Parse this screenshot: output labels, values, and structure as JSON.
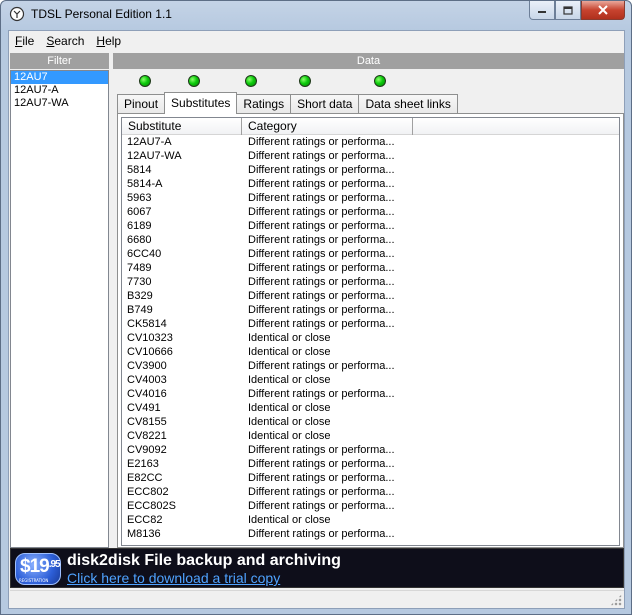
{
  "window": {
    "title": "TDSL Personal Edition 1.1"
  },
  "menu": [
    {
      "label": "File",
      "accel": "F",
      "rest": "ile"
    },
    {
      "label": "Search",
      "accel": "S",
      "rest": "earch"
    },
    {
      "label": "Help",
      "accel": "H",
      "rest": "elp"
    }
  ],
  "filter": {
    "header": "Filter",
    "items": [
      "12AU7",
      "12AU7-A",
      "12AU7-WA"
    ],
    "selected_index": 0
  },
  "data": {
    "header": "Data",
    "led_count": 5,
    "led_color": "#0ccb0c"
  },
  "tabs": [
    "Pinout",
    "Substitutes",
    "Ratings",
    "Short data",
    "Data sheet links"
  ],
  "active_tab": "Substitutes",
  "grid": {
    "columns": [
      "Substitute",
      "Category",
      ""
    ],
    "rows": [
      [
        "12AU7-A",
        "Different ratings or performa..."
      ],
      [
        "12AU7-WA",
        "Different ratings or performa..."
      ],
      [
        "5814",
        "Different ratings or performa..."
      ],
      [
        "5814-A",
        "Different ratings or performa..."
      ],
      [
        "5963",
        "Different ratings or performa..."
      ],
      [
        "6067",
        "Different ratings or performa..."
      ],
      [
        "6189",
        "Different ratings or performa..."
      ],
      [
        "6680",
        "Different ratings or performa..."
      ],
      [
        "6CC40",
        "Different ratings or performa..."
      ],
      [
        "7489",
        "Different ratings or performa..."
      ],
      [
        "7730",
        "Different ratings or performa..."
      ],
      [
        "B329",
        "Different ratings or performa..."
      ],
      [
        "B749",
        "Different ratings or performa..."
      ],
      [
        "CK5814",
        "Different ratings or performa..."
      ],
      [
        "CV10323",
        "Identical or close"
      ],
      [
        "CV10666",
        "Identical or close"
      ],
      [
        "CV3900",
        "Different ratings or performa..."
      ],
      [
        "CV4003",
        "Identical or close"
      ],
      [
        "CV4016",
        "Different ratings or performa..."
      ],
      [
        "CV491",
        "Identical or close"
      ],
      [
        "CV8155",
        "Identical or close"
      ],
      [
        "CV8221",
        "Identical or close"
      ],
      [
        "CV9092",
        "Different ratings or performa..."
      ],
      [
        "E2163",
        "Different ratings or performa..."
      ],
      [
        "E82CC",
        "Different ratings or performa..."
      ],
      [
        "ECC802",
        "Different ratings or performa..."
      ],
      [
        "ECC802S",
        "Different ratings or performa..."
      ],
      [
        "ECC82",
        "Identical or close"
      ],
      [
        "M8136",
        "Different ratings or performa..."
      ]
    ]
  },
  "banner": {
    "price_main": "$19",
    "price_cents": ".95",
    "price_sub": "REGISTRATION",
    "title": "disk2disk File backup and archiving",
    "link": "Click here to download a trial copy"
  }
}
